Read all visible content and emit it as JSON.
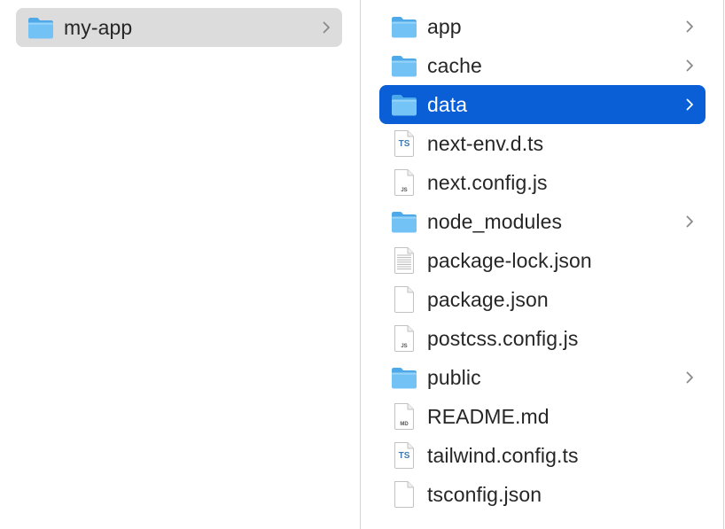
{
  "column1": {
    "items": [
      {
        "name": "my-app",
        "type": "folder",
        "has_children": true,
        "state": "parent-selected"
      }
    ]
  },
  "column2": {
    "items": [
      {
        "name": "app",
        "type": "folder",
        "has_children": true
      },
      {
        "name": "cache",
        "type": "folder",
        "has_children": true
      },
      {
        "name": "data",
        "type": "folder",
        "has_children": true,
        "state": "selected"
      },
      {
        "name": "next-env.d.ts",
        "type": "file-ts",
        "badge": "TS"
      },
      {
        "name": "next.config.js",
        "type": "file-js",
        "badge": "JS"
      },
      {
        "name": "node_modules",
        "type": "folder",
        "has_children": true
      },
      {
        "name": "package-lock.json",
        "type": "file-text"
      },
      {
        "name": "package.json",
        "type": "file-plain"
      },
      {
        "name": "postcss.config.js",
        "type": "file-js",
        "badge": "JS"
      },
      {
        "name": "public",
        "type": "folder",
        "has_children": true
      },
      {
        "name": "README.md",
        "type": "file-md",
        "badge": "MD"
      },
      {
        "name": "tailwind.config.ts",
        "type": "file-ts",
        "badge": "TS"
      },
      {
        "name": "tsconfig.json",
        "type": "file-plain"
      }
    ]
  },
  "colors": {
    "selection_blue": "#0a5fd7",
    "parent_selection_gray": "#dcdcdc",
    "folder_blue": "#5ab4ef",
    "text": "#262626"
  },
  "icons": {
    "folder": "folder-icon",
    "typescript": "typescript-file-icon",
    "javascript": "javascript-file-icon",
    "text": "text-file-icon",
    "plain": "document-icon",
    "markdown": "markdown-file-icon",
    "chevron": "chevron-right-icon"
  }
}
